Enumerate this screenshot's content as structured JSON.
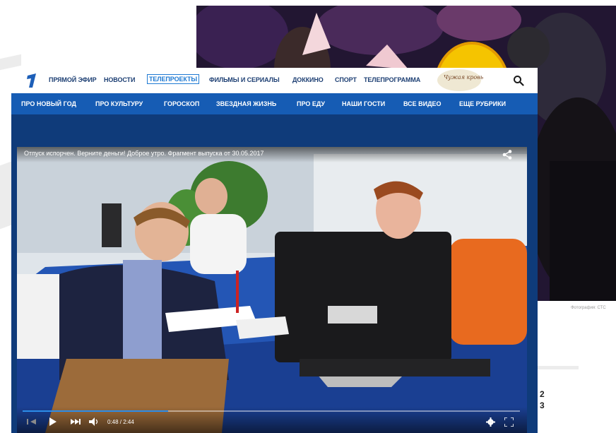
{
  "nav": {
    "items": [
      {
        "label": "ПРЯМОЙ ЭФИР",
        "active": false
      },
      {
        "label": "НОВОСТИ",
        "active": false
      },
      {
        "label": "ТЕЛЕПРОЕКТЫ",
        "active": true
      },
      {
        "label": "ФИЛЬМЫ И СЕРИАЛЫ",
        "active": false
      },
      {
        "label": "ДОККИНО",
        "active": false
      },
      {
        "label": "СПОРТ",
        "active": false
      },
      {
        "label": "ТЕЛЕПРОГРАММА",
        "active": false
      }
    ],
    "brand_label": "Чужая кровь",
    "search_icon": "search-icon",
    "logo_icon": "channel-one-logo"
  },
  "subnav": {
    "items": [
      {
        "label": "ПРО НОВЫЙ ГОД"
      },
      {
        "label": "ПРО КУЛЬТУРУ"
      },
      {
        "label": "ГОРОСКОП"
      },
      {
        "label": "ЗВЕЗДНАЯ ЖИЗНЬ"
      },
      {
        "label": "ПРО ЕДУ"
      },
      {
        "label": "НАШИ ГОСТИ"
      },
      {
        "label": "ВСЕ ВИДЕО"
      },
      {
        "label": "ЕЩЕ РУБРИКИ"
      }
    ]
  },
  "player": {
    "title": "Отпуск испорчен. Верните деньги! Доброе утро. Фрагмент выпуска от 30.05.2017",
    "timecode": "0:48 / 2:44",
    "progress": 0.293,
    "controls": [
      "prev-icon",
      "play-icon",
      "next-icon",
      "volume-icon",
      "settings-icon",
      "fullscreen-icon",
      "share-icon"
    ]
  },
  "background": {
    "caption": "Фотография: СТС"
  },
  "page_number": "2\n3",
  "colors": {
    "accent": "#1f7ad3",
    "nav_text": "#1d3f73",
    "subnav_bg": "#165cb4",
    "window_bg": "#0f3b7a"
  }
}
